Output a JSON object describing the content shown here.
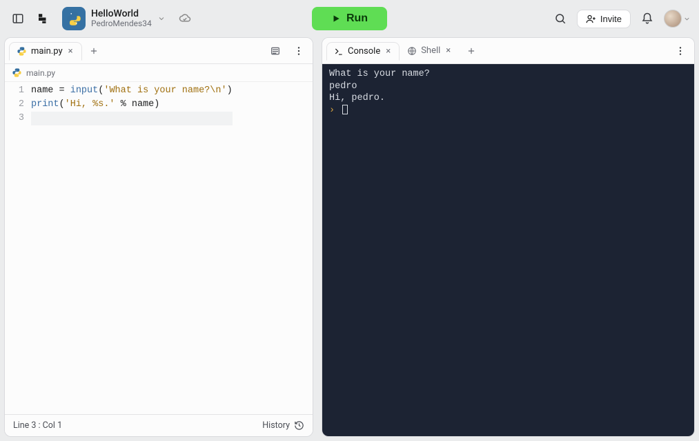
{
  "header": {
    "repl_name": "HelloWorld",
    "owner": "PedroMendes34",
    "run_label": "Run",
    "invite_label": "Invite"
  },
  "editor": {
    "tab_label": "main.py",
    "breadcrumb": "main.py",
    "lines": [
      {
        "num": "1",
        "tokens": [
          {
            "text": "name",
            "cls": "tk-name"
          },
          {
            "text": " ",
            "cls": ""
          },
          {
            "text": "=",
            "cls": "tk-op"
          },
          {
            "text": " ",
            "cls": ""
          },
          {
            "text": "input",
            "cls": "tk-func"
          },
          {
            "text": "(",
            "cls": "tk-punc"
          },
          {
            "text": "'What is your name?\\n'",
            "cls": "tk-str"
          },
          {
            "text": ")",
            "cls": "tk-punc"
          }
        ]
      },
      {
        "num": "2",
        "tokens": [
          {
            "text": "print",
            "cls": "tk-func"
          },
          {
            "text": "(",
            "cls": "tk-punc"
          },
          {
            "text": "'Hi, %s.'",
            "cls": "tk-str"
          },
          {
            "text": " ",
            "cls": ""
          },
          {
            "text": "%",
            "cls": "tk-op"
          },
          {
            "text": " ",
            "cls": ""
          },
          {
            "text": "name",
            "cls": "tk-name"
          },
          {
            "text": ")",
            "cls": "tk-punc"
          }
        ]
      },
      {
        "num": "3",
        "tokens": [],
        "current": true
      }
    ],
    "status_left": "Line 3 : Col 1",
    "status_right": "History"
  },
  "console": {
    "tab_console": "Console",
    "tab_shell": "Shell",
    "lines": [
      "What is your name?",
      "pedro",
      "Hi, pedro."
    ],
    "prompt": "›"
  }
}
